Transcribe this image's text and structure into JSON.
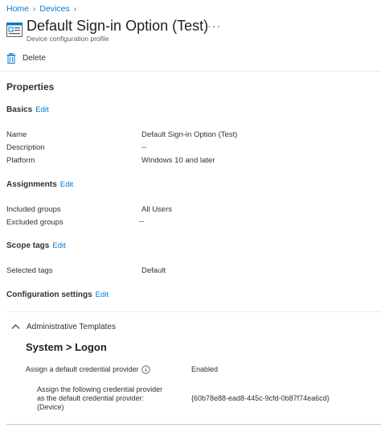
{
  "breadcrumb": {
    "items": [
      "Home",
      "Devices"
    ]
  },
  "header": {
    "title": "Default Sign-in Option (Test)",
    "subtitle": "Device configuration profile",
    "more_label": "···"
  },
  "toolbar": {
    "delete_label": "Delete"
  },
  "properties_heading": "Properties",
  "edit_label": "Edit",
  "basics": {
    "heading": "Basics",
    "rows": [
      {
        "label": "Name",
        "value": "Default Sign-in Option (Test)"
      },
      {
        "label": "Description",
        "value": "--"
      },
      {
        "label": "Platform",
        "value": "Windows 10 and later"
      }
    ]
  },
  "assignments": {
    "heading": "Assignments",
    "rows": [
      {
        "label": "Included groups",
        "value": "All Users"
      },
      {
        "label": "Excluded groups",
        "value": "--"
      }
    ]
  },
  "scope_tags": {
    "heading": "Scope tags",
    "rows": [
      {
        "label": "Selected tags",
        "value": "Default"
      }
    ]
  },
  "configuration_settings": {
    "heading": "Configuration settings",
    "group_label": "Administrative Templates",
    "category_heading": "System > Logon",
    "setting": {
      "label": "Assign a default credential provider",
      "value": "Enabled"
    },
    "sub_setting": {
      "label": "Assign the following credential provider\nas the default credential provider:\n(Device)",
      "value": "{60b78e88-ead8-445c-9cfd-0b87f74ea6cd}"
    }
  },
  "colors": {
    "accent": "#0078d4",
    "text": "#323130",
    "secondary_text": "#605e5c",
    "divider": "#edebe9"
  },
  "icons": {
    "profile": "device-configuration-profile-icon",
    "delete": "trash-icon",
    "more": "more-ellipsis-icon",
    "collapse": "chevron-up-icon",
    "info": "info-icon",
    "breadcrumb_separator": "chevron-right-icon"
  }
}
